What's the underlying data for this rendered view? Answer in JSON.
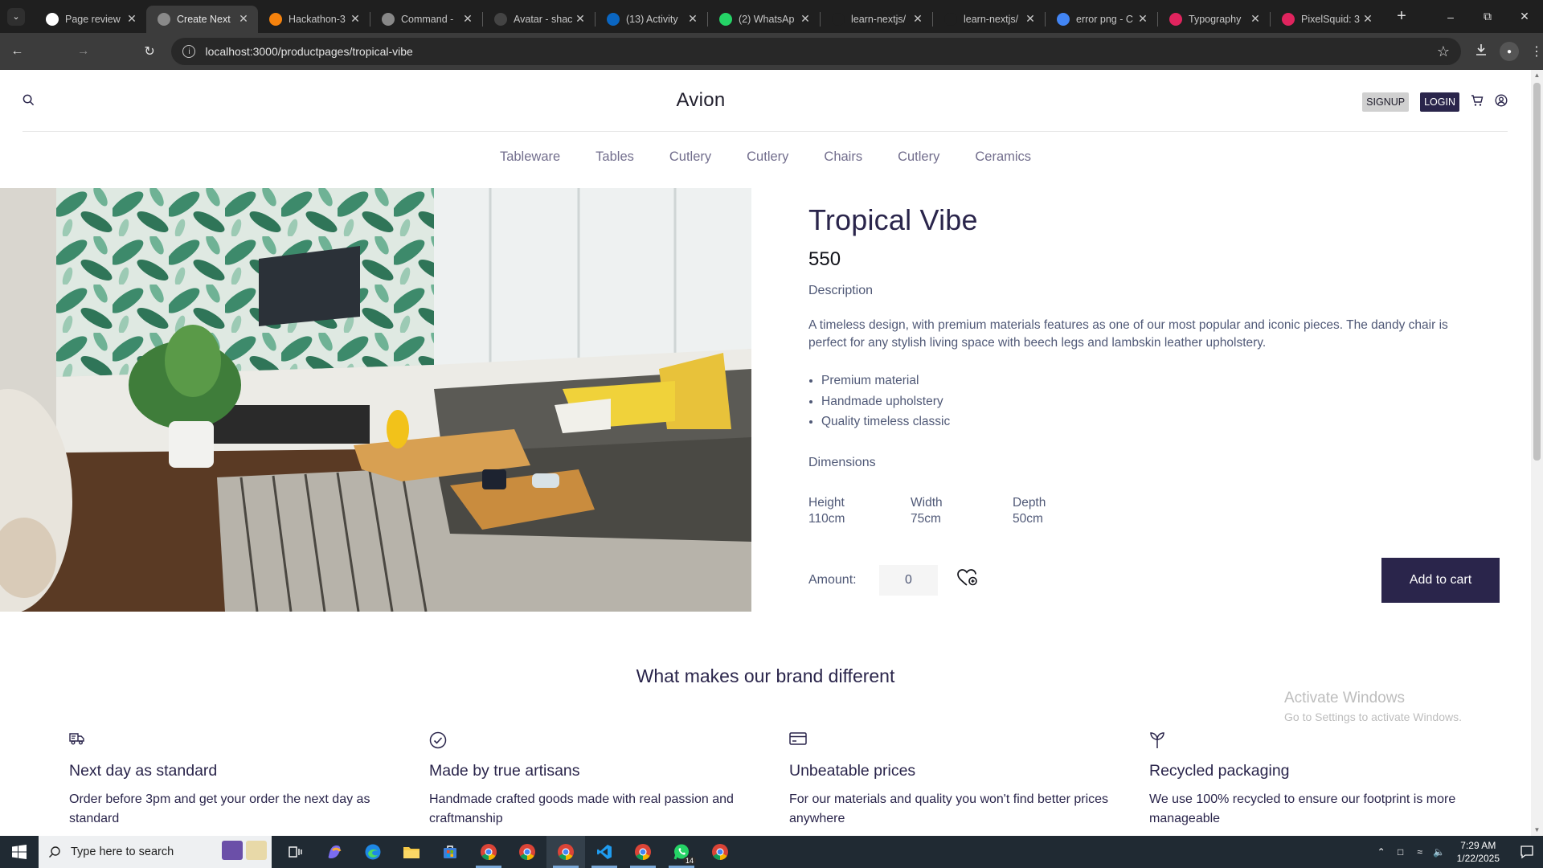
{
  "browser": {
    "tabs": [
      {
        "title": "Page review",
        "active": false,
        "favicon_color": "#ffffff"
      },
      {
        "title": "Create Next",
        "active": true,
        "favicon_color": "#8a8a8a"
      },
      {
        "title": "Hackathon-3",
        "active": false,
        "favicon_color": "#f5820d"
      },
      {
        "title": "Command -",
        "active": false,
        "favicon_color": "#888888"
      },
      {
        "title": "Avatar - shac",
        "active": false,
        "favicon_color": "#444444"
      },
      {
        "title": "(13) Activity",
        "active": false,
        "favicon_color": "#0a66c2"
      },
      {
        "title": "(2) WhatsAp",
        "active": false,
        "favicon_color": "#25d366"
      },
      {
        "title": "learn-nextjs/",
        "active": false,
        "favicon_color": "#1f1f1f"
      },
      {
        "title": "learn-nextjs/",
        "active": false,
        "favicon_color": "#1f1f1f"
      },
      {
        "title": "error png - C",
        "active": false,
        "favicon_color": "#4285f4"
      },
      {
        "title": "Typography",
        "active": false,
        "favicon_color": "#e0245e"
      },
      {
        "title": "PixelSquid: 3",
        "active": false,
        "favicon_color": "#e0245e"
      }
    ],
    "new_tab_label": "+",
    "url": "localhost:3000/productpages/tropical-vibe"
  },
  "site": {
    "logo": "Avion",
    "signup_label": "SIGNUP",
    "login_label": "LOGIN",
    "nav": [
      "Tableware",
      "Tables",
      "Cutlery",
      "Cutlery",
      "Chairs",
      "Cutlery",
      "Ceramics"
    ]
  },
  "product": {
    "title": "Tropical Vibe",
    "price": "550",
    "description_heading": "Description",
    "description": "A timeless design, with premium materials features as one of our most popular and iconic pieces. The dandy chair is perfect for any stylish living space with beech legs and lambskin leather upholstery.",
    "features": [
      "Premium material",
      "Handmade upholstery",
      "Quality timeless classic"
    ],
    "dimensions_heading": "Dimensions",
    "dimensions": [
      {
        "label": "Height",
        "value": "110cm"
      },
      {
        "label": "Width",
        "value": "75cm"
      },
      {
        "label": "Depth",
        "value": "50cm"
      }
    ],
    "amount_label": "Amount:",
    "amount_value": "0",
    "add_to_cart_label": "Add to cart"
  },
  "brand": {
    "heading": "What makes our brand different",
    "items": [
      {
        "icon": "delivery-truck-icon",
        "title": "Next day as standard",
        "text": "Order before 3pm and get your order the next day as standard"
      },
      {
        "icon": "check-circle-icon",
        "title": "Made by true artisans",
        "text": "Handmade crafted goods made with real passion and craftmanship"
      },
      {
        "icon": "credit-card-icon",
        "title": "Unbeatable prices",
        "text": "For our materials and quality you won't find better prices anywhere"
      },
      {
        "icon": "sprout-icon",
        "title": "Recycled packaging",
        "text": "We use 100% recycled to ensure our footprint is more manageable"
      }
    ]
  },
  "watermark": {
    "line1": "Activate Windows",
    "line2": "Go to Settings to activate Windows."
  },
  "taskbar": {
    "search_placeholder": "Type here to search",
    "time": "7:29 AM",
    "date": "1/22/2025",
    "whatsapp_badge": "14"
  }
}
